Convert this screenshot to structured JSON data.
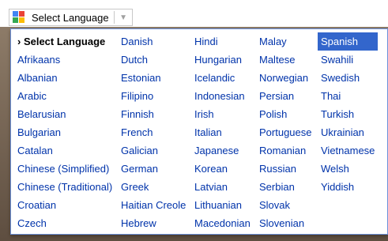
{
  "selector": {
    "label": "Select Language",
    "arrow_icon": "triangle-down-icon",
    "logo_icon": "google-g-icon"
  },
  "menu": {
    "selected_item": "Spanish",
    "colors": {
      "link": "#0033aa",
      "highlight": "#3366cc",
      "border": "#6b90da"
    },
    "columns": [
      [
        "› Select Language",
        "Afrikaans",
        "Albanian",
        "Arabic",
        "Belarusian",
        "Bulgarian",
        "Catalan",
        "Chinese (Simplified)",
        "Chinese (Traditional)",
        "Croatian",
        "Czech"
      ],
      [
        "Danish",
        "Dutch",
        "Estonian",
        "Filipino",
        "Finnish",
        "French",
        "Galician",
        "German",
        "Greek",
        "Haitian Creole",
        "Hebrew"
      ],
      [
        "Hindi",
        "Hungarian",
        "Icelandic",
        "Indonesian",
        "Irish",
        "Italian",
        "Japanese",
        "Korean",
        "Latvian",
        "Lithuanian",
        "Macedonian"
      ],
      [
        "Malay",
        "Maltese",
        "Norwegian",
        "Persian",
        "Polish",
        "Portuguese",
        "Romanian",
        "Russian",
        "Serbian",
        "Slovak",
        "Slovenian"
      ],
      [
        "Spanish",
        "Swahili",
        "Swedish",
        "Thai",
        "Turkish",
        "Ukrainian",
        "Vietnamese",
        "Welsh",
        "Yiddish"
      ]
    ]
  }
}
